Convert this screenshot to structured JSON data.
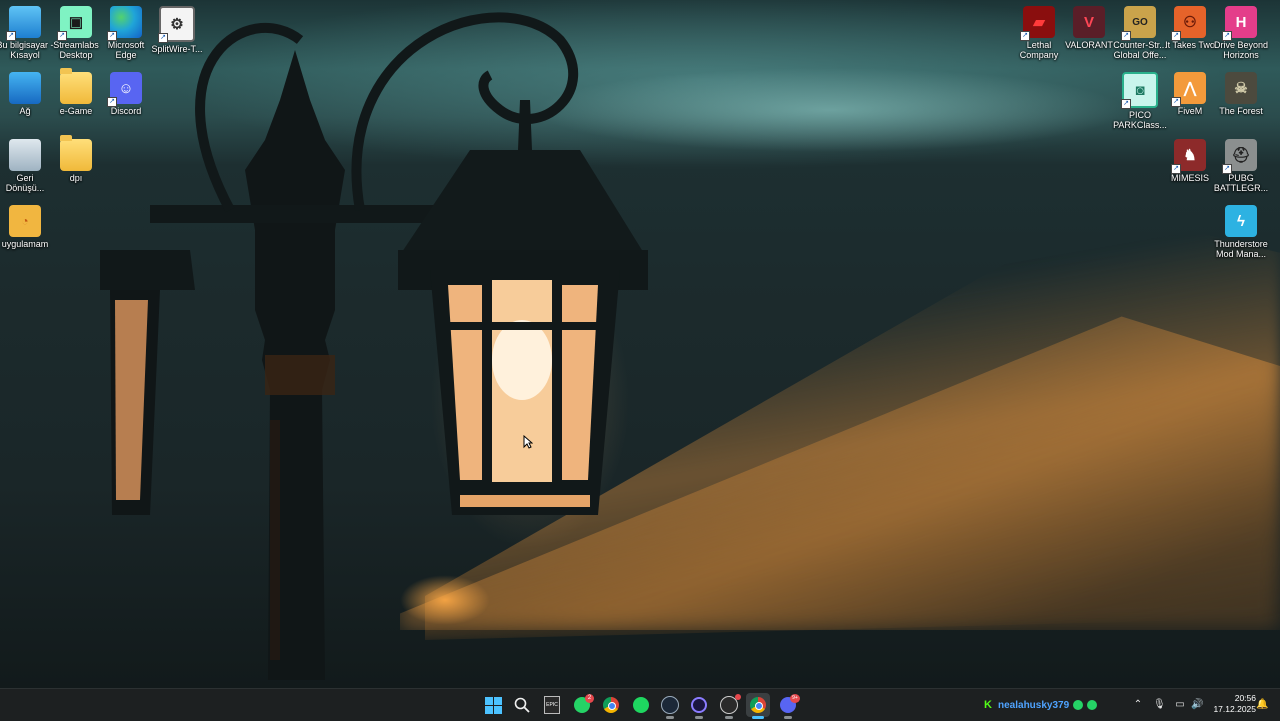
{
  "desktop": {
    "left_icons": [
      {
        "label": "Bu bilgisayar - Kısayol",
        "icon": "computer-icon"
      },
      {
        "label": "Streamlabs Desktop",
        "icon": "streamlabs-icon"
      },
      {
        "label": "Microsoft Edge",
        "icon": "edge-icon"
      },
      {
        "label": "SplitWire-T...",
        "icon": "splitwire-icon"
      },
      {
        "label": "Ağ",
        "icon": "network-icon"
      },
      {
        "label": "e-Game",
        "icon": "folder-icon"
      },
      {
        "label": "Discord",
        "icon": "discord-icon"
      },
      {
        "label": "Geri Dönüşü...",
        "icon": "recycle-bin-icon"
      },
      {
        "label": "dpı",
        "icon": "folder-icon"
      },
      {
        "label": "uygulamam",
        "icon": "app-folder-icon"
      }
    ],
    "right_icons": [
      {
        "label": "Lethal Company",
        "icon": "lethal-company-icon"
      },
      {
        "label": "VALORANT",
        "icon": "valorant-icon"
      },
      {
        "label": "Counter-Str... Global Offe...",
        "icon": "csgo-icon"
      },
      {
        "label": "It Takes Two",
        "icon": "it-takes-two-icon"
      },
      {
        "label": "Drive Beyond Horizons",
        "icon": "drive-beyond-horizons-icon"
      },
      {
        "label": "PICO PARKClass...",
        "icon": "pico-park-icon"
      },
      {
        "label": "FiveM",
        "icon": "fivem-icon"
      },
      {
        "label": "The Forest",
        "icon": "the-forest-icon"
      },
      {
        "label": "MIMESIS",
        "icon": "mimesis-icon"
      },
      {
        "label": "PUBG BATTLEGR...",
        "icon": "pubg-icon"
      },
      {
        "label": "Thunderstore Mod Mana...",
        "icon": "thunderstore-icon"
      }
    ]
  },
  "taskbar": {
    "apps": [
      {
        "name": "start",
        "icon": "windows-start-icon"
      },
      {
        "name": "search",
        "icon": "search-icon"
      },
      {
        "name": "epic",
        "icon": "epic-games-icon",
        "glyph": "EPIC"
      },
      {
        "name": "whatsapp",
        "icon": "whatsapp-icon",
        "badge": "2"
      },
      {
        "name": "chrome",
        "icon": "chrome-icon"
      },
      {
        "name": "spotify",
        "icon": "spotify-icon"
      },
      {
        "name": "steam",
        "icon": "steam-icon"
      },
      {
        "name": "app",
        "icon": "circle-app-icon"
      },
      {
        "name": "valorant-tracker",
        "icon": "tracker-icon"
      },
      {
        "name": "chrome-active",
        "icon": "chrome-icon"
      },
      {
        "name": "discord",
        "icon": "discord-icon",
        "badge": "9+"
      }
    ],
    "tray": {
      "kick_username": "nealahusky379",
      "time": "20:56",
      "date": "17.12.2025"
    }
  }
}
